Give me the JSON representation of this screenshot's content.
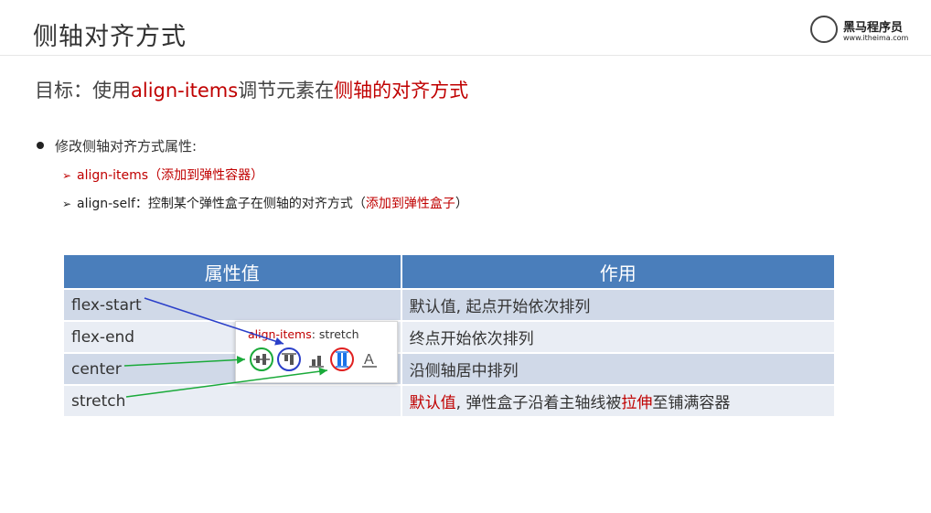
{
  "header": {
    "title": "侧轴对齐方式",
    "logo_brand": "黑马程序员",
    "logo_url": "www.itheima.com"
  },
  "goal": {
    "prefix": "目标：使用",
    "highlight1": "align-items",
    "middle": "调节元素在",
    "highlight2": "侧轴的对齐方式"
  },
  "bullet": {
    "text": "修改侧轴对齐方式属性:"
  },
  "sub1": {
    "name": "align-items",
    "note": "（添加到弹性容器）"
  },
  "sub2": {
    "name": "align-self：",
    "desc": "控制某个弹性盒子在侧轴的对齐方式（",
    "note": "添加到弹性盒子",
    "close": "）"
  },
  "table": {
    "headers": [
      "属性值",
      "作用"
    ],
    "rows": [
      {
        "value": "flex-start",
        "desc": "默认值, 起点开始依次排列"
      },
      {
        "value": "flex-end",
        "desc": "终点开始依次排列"
      },
      {
        "value": "center",
        "desc": "沿侧轴居中排列"
      },
      {
        "value": "stretch",
        "desc_red1": "默认值",
        "desc_mid": ", 弹性盒子沿着主轴线被",
        "desc_red2": "拉伸",
        "desc_end": "至铺满容器"
      }
    ]
  },
  "popup": {
    "prop": "align-items",
    "value": ": stretch",
    "icons": [
      "align-center-icon",
      "align-flex-start-icon",
      "align-flex-end-icon",
      "align-stretch-icon",
      "align-baseline-icon"
    ]
  },
  "colors": {
    "header_bg": "#4a7ebb",
    "row_dark": "#d0d9e8",
    "row_light": "#e9edf4",
    "accent_red": "#c00000",
    "arrow_blue": "#2a3fc9",
    "arrow_green": "#1aaa3a"
  }
}
